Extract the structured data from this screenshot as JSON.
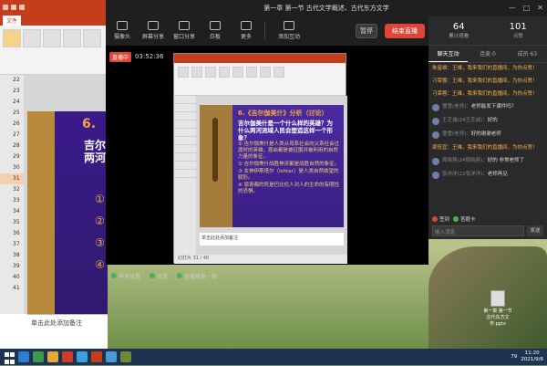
{
  "ppt": {
    "tab_file": "文件",
    "ribbon_paste": "粘贴",
    "ribbon_new": "新建\n幻灯片",
    "slide_num_label": "6.",
    "slide_big_text": "吉尔\n两河",
    "slide_bullets": "①\n②\n③\n④",
    "notes": "单击此处添加备注",
    "thumb_numbers": [
      "22",
      "23",
      "24",
      "25",
      "26",
      "27",
      "28",
      "29",
      "30",
      "31",
      "32",
      "33",
      "34",
      "35",
      "36",
      "37",
      "38",
      "39",
      "40",
      "41"
    ]
  },
  "live": {
    "title": "第一章 第一节 古代文学概述、古代东方文学",
    "win_ctrls": [
      "—",
      "□",
      "✕"
    ],
    "toolbar": [
      {
        "label": "摄像头",
        "name": "tool-camera"
      },
      {
        "label": "屏幕分享",
        "name": "tool-screen-share"
      },
      {
        "label": "窗口分享",
        "name": "tool-window-share"
      },
      {
        "label": "白板",
        "name": "tool-whiteboard"
      },
      {
        "label": "更多",
        "name": "tool-more"
      },
      {
        "label": "添加互动",
        "name": "tool-add-interaction"
      }
    ],
    "pause_label": "暂停",
    "end_label": "结束直播",
    "rec_badge": "直播中",
    "rec_time": "03:52:36",
    "bottom": [
      {
        "label": "声音设置",
        "name": "sound-settings-button"
      },
      {
        "label": "设置",
        "name": "settings-button"
      },
      {
        "label": "直播质量一般",
        "name": "quality-indicator"
      }
    ]
  },
  "slide": {
    "heading": "6.《吉尔伽美什》分析（讨论）",
    "question": "吉尔伽美什是一个什么样的英雄？为什么两河流域人民会塑造这样一个形象？",
    "bullets": [
      "① 吉尔伽美什是人类从母系社会向父系社会过渡时的英雄，恩启都是被征服并被利用的自然力量的象征。",
      "② 吉尔伽美什战胜神灵都是战胜自然的象征。",
      "③ 女神伊斯塔尔（Ishtar）是人类自然欲望的赋形。",
      "④ 恩奇都的死是巴比伦人对人的生命的有限性的恐惧。"
    ],
    "notes": "单击此处添加备注",
    "status": "幻灯片 31 / 40"
  },
  "stats": [
    {
      "value": "64",
      "label": "累计观看"
    },
    {
      "value": "101",
      "label": "点赞"
    }
  ],
  "side_tabs": [
    "聊天互动",
    "连麦·0",
    "成员·63"
  ],
  "chat": [
    {
      "name": "朱星维：",
      "text": "王维，我来我们的直播间，为你点赞！",
      "highlight": true
    },
    {
      "name": "刁荣蓉：",
      "text": "王维，我来我们的直播间，为你点赞！",
      "highlight": true
    },
    {
      "name": "刁荣蓉：",
      "text": "王维，我来我们的直播间，为你点赞！",
      "highlight": true
    },
    {
      "name": "曹雪(老师)：",
      "text": "老师能发下课件吗？",
      "highlight": false
    },
    {
      "name": "王芝诚(24王芝诚)：",
      "text": "好的",
      "highlight": false
    },
    {
      "name": "曹雪(老师)：",
      "text": "好的谢谢老师",
      "highlight": false
    },
    {
      "name": "梁佳宜：",
      "text": "王维，我来我们的直播间，为你点赞！",
      "highlight": true
    },
    {
      "name": "周晓燕(24周晓燕)：",
      "text": "好的 非常老师了",
      "highlight": false
    },
    {
      "name": "张洋洋(22张洋洋)：",
      "text": "老师再见",
      "highlight": false
    }
  ],
  "side_foot": {
    "chip_gift": "签到",
    "chip_card": "答题卡",
    "input_placeholder": "输入消息",
    "send_label": "发送"
  },
  "desktop_icon_label": "第一章 第一节 古代东方文学.pptx",
  "taskbar": {
    "time": "11:20",
    "date": "2021/9/6",
    "battery": "79"
  },
  "colors": {
    "end_button": "#e0453a",
    "slide_bg": "#3a1f85",
    "slide_accent": "#f2a83a",
    "ppt_red": "#c43e1c"
  }
}
